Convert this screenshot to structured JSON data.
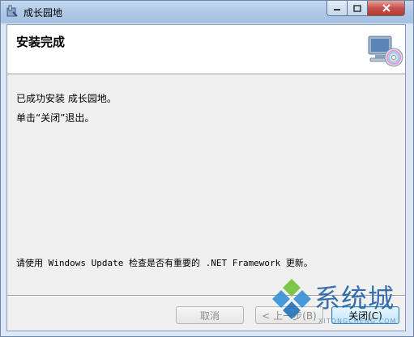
{
  "window": {
    "title": "成长园地"
  },
  "banner": {
    "title": "安装完成"
  },
  "body": {
    "line1": "已成功安装 成长园地。",
    "line2": "单击“关闭”退出。",
    "line3": "请使用 Windows Update 检查是否有重要的 .NET Framework 更新。"
  },
  "buttons": {
    "cancel": "取消",
    "previous": "< 上一步(B)",
    "close": "关闭(C)"
  },
  "watermark": {
    "brand": "系统城",
    "url": "XITONGCHENG.COM"
  },
  "colors": {
    "titlebar": "#afc8e6",
    "close_button": "#c75050",
    "watermark": "#1c5fa3"
  }
}
